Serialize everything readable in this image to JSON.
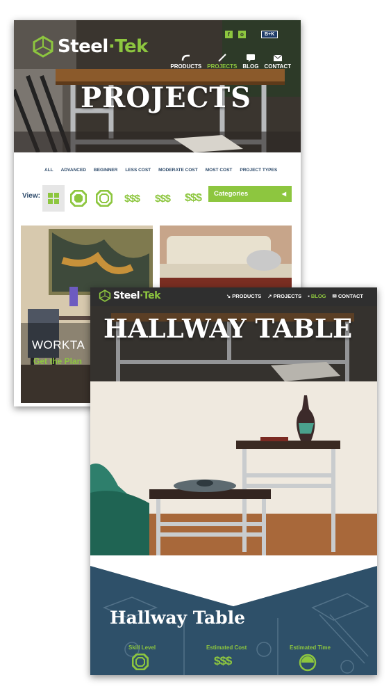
{
  "card1": {
    "logo": {
      "part1": "Steel",
      "part2": "Tek",
      "icon": "hexagon-cube-icon"
    },
    "social": {
      "facebook": "f",
      "instagram": "o",
      "partner": "B+K"
    },
    "nav": [
      {
        "label": "PRODUCTS",
        "icon": "pipe-fitting-icon",
        "active": false
      },
      {
        "label": "PROJECTS",
        "icon": "wrench-icon",
        "active": true
      },
      {
        "label": "BLOG",
        "icon": "chat-bubble-icon",
        "active": false
      },
      {
        "label": "CONTACT",
        "icon": "envelope-icon",
        "active": false
      }
    ],
    "title": "PROJECTS",
    "filters": [
      "ALL",
      "ADVANCED",
      "BEGINNER",
      "LESS COST",
      "MODERATE COST",
      "MOST COST",
      "PROJECT TYPES"
    ],
    "view_label": "View:",
    "view_icons": [
      "grid-icon",
      "octagon-advanced-icon",
      "octagon-beginner-icon",
      "$$$",
      "$$$",
      "$$$"
    ],
    "categories_label": "Categories",
    "thumbs": [
      {
        "title": "WORKTA",
        "link": "Get the Plan"
      },
      {
        "title": "",
        "link": ""
      }
    ]
  },
  "card2": {
    "logo": {
      "part1": "Steel",
      "part2": "Tek"
    },
    "nav": [
      {
        "label": "PRODUCTS",
        "icon": "pipe-fitting-icon",
        "active": false
      },
      {
        "label": "PROJECTS",
        "icon": "wrench-icon",
        "active": false
      },
      {
        "label": "BLOG",
        "icon": "chat-bubble-icon",
        "active": true
      },
      {
        "label": "CONTACT",
        "icon": "envelope-icon",
        "active": false
      }
    ],
    "hero_title": "HALLWAY TABLE",
    "project_title": "Hallway Table",
    "stats": [
      {
        "label": "Skill Level",
        "icon": "skill-octagon-icon"
      },
      {
        "label": "Estimated Cost",
        "value": "$$$"
      },
      {
        "label": "Estimated Time",
        "icon": "clock-pie-icon"
      }
    ]
  },
  "colors": {
    "green": "#8dc63f",
    "navy": "#2e5069",
    "dark": "#2f2f2f"
  }
}
